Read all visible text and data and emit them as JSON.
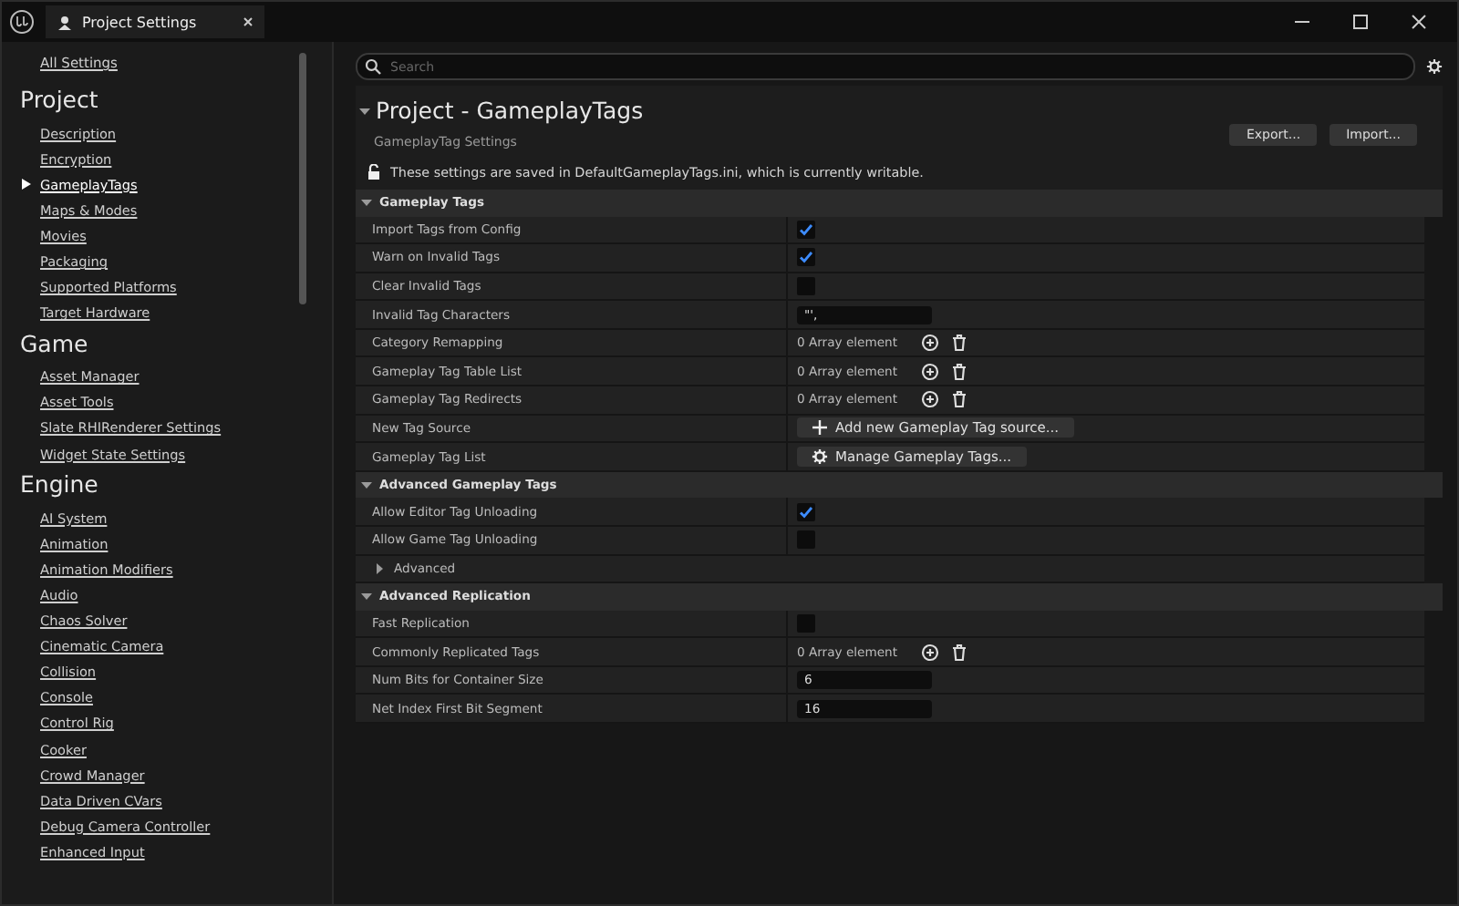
{
  "window": {
    "tab_title": "Project Settings"
  },
  "sidebar": {
    "all_settings": "All Settings",
    "groups": [
      {
        "title": "Project",
        "items": [
          {
            "label": "Description",
            "selected": false
          },
          {
            "label": "Encryption",
            "selected": false
          },
          {
            "label": "GameplayTags",
            "selected": true
          },
          {
            "label": "Maps & Modes",
            "selected": false
          },
          {
            "label": "Movies",
            "selected": false
          },
          {
            "label": "Packaging",
            "selected": false
          },
          {
            "label": "Supported Platforms",
            "selected": false
          },
          {
            "label": "Target Hardware",
            "selected": false
          }
        ]
      },
      {
        "title": "Game",
        "items": [
          {
            "label": "Asset Manager",
            "selected": false
          },
          {
            "label": "Asset Tools",
            "selected": false
          },
          {
            "label": "Slate RHIRenderer Settings",
            "selected": false
          },
          {
            "label": "Widget State Settings",
            "selected": false
          }
        ]
      },
      {
        "title": "Engine",
        "items": [
          {
            "label": "AI System",
            "selected": false
          },
          {
            "label": "Animation",
            "selected": false
          },
          {
            "label": "Animation Modifiers",
            "selected": false
          },
          {
            "label": "Audio",
            "selected": false
          },
          {
            "label": "Chaos Solver",
            "selected": false
          },
          {
            "label": "Cinematic Camera",
            "selected": false
          },
          {
            "label": "Collision",
            "selected": false
          },
          {
            "label": "Console",
            "selected": false
          },
          {
            "label": "Control Rig",
            "selected": false
          },
          {
            "label": "Cooker",
            "selected": false
          },
          {
            "label": "Crowd Manager",
            "selected": false
          },
          {
            "label": "Data Driven CVars",
            "selected": false
          },
          {
            "label": "Debug Camera Controller",
            "selected": false
          },
          {
            "label": "Enhanced Input",
            "selected": false
          }
        ]
      }
    ]
  },
  "search": {
    "placeholder": "Search"
  },
  "header": {
    "title": "Project - GameplayTags",
    "subtitle": "GameplayTag Settings",
    "buttons": [
      "Export...",
      "Import..."
    ],
    "notice": "These settings are saved in DefaultGameplayTags.ini, which is currently writable."
  },
  "sections": [
    {
      "title": "Gameplay Tags",
      "expanded": true,
      "rows": [
        {
          "kind": "checkbox",
          "label": "Import Tags from Config",
          "checked": true
        },
        {
          "kind": "checkbox",
          "label": "Warn on Invalid Tags",
          "checked": true
        },
        {
          "kind": "checkbox",
          "label": "Clear Invalid Tags",
          "checked": false
        },
        {
          "kind": "field",
          "label": "Invalid Tag Characters",
          "value": "\"',"
        },
        {
          "kind": "array",
          "label": "Category Remapping",
          "value": "0 Array element"
        },
        {
          "kind": "array",
          "label": "Gameplay Tag Table List",
          "value": "0 Array element"
        },
        {
          "kind": "array",
          "label": "Gameplay Tag Redirects",
          "value": "0 Array element"
        },
        {
          "kind": "add",
          "label": "New Tag Source",
          "button": "Add new Gameplay Tag source..."
        },
        {
          "kind": "manage",
          "label": "Gameplay Tag List",
          "button": "Manage Gameplay Tags..."
        }
      ]
    },
    {
      "title": "Advanced Gameplay Tags",
      "expanded": true,
      "rows": [
        {
          "kind": "checkbox",
          "label": "Allow Editor Tag Unloading",
          "checked": true
        },
        {
          "kind": "checkbox",
          "label": "Allow Game Tag Unloading",
          "checked": false
        },
        {
          "kind": "group",
          "label": "Advanced",
          "expanded": false
        }
      ]
    },
    {
      "title": "Advanced Replication",
      "expanded": true,
      "rows": [
        {
          "kind": "checkbox",
          "label": "Fast Replication",
          "checked": false
        },
        {
          "kind": "array",
          "label": "Commonly Replicated Tags",
          "value": "0 Array element"
        },
        {
          "kind": "field",
          "label": "Num Bits for Container Size",
          "value": "6"
        },
        {
          "kind": "field",
          "label": "Net Index First Bit Segment",
          "value": "16"
        }
      ]
    }
  ]
}
